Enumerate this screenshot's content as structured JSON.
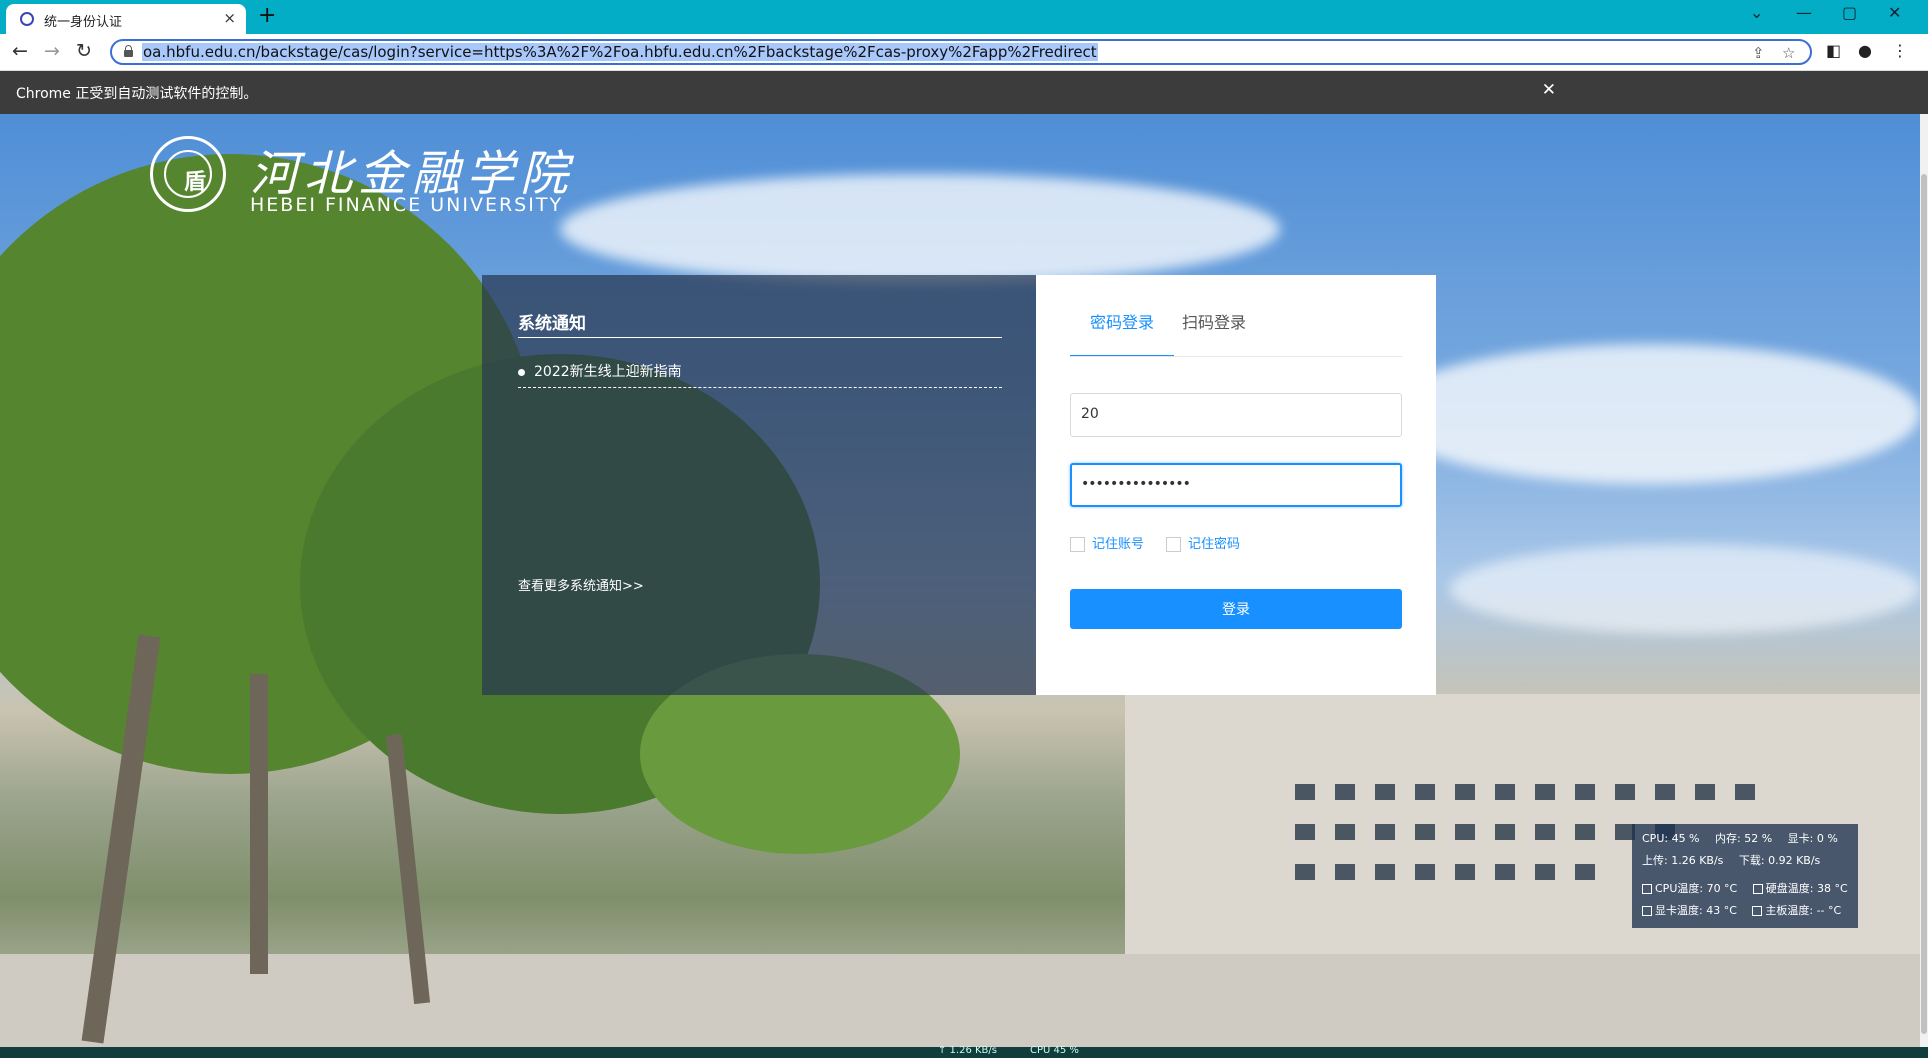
{
  "browser": {
    "tab_title": "统一身份认证",
    "tab_close": "×",
    "new_tab": "+",
    "window_controls": [
      "⌄",
      "—",
      "▢",
      "✕"
    ],
    "url": "oa.hbfu.edu.cn/backstage/cas/login?service=https%3A%2F%2Foa.hbfu.edu.cn%2Fbackstage%2Fcas-proxy%2Fapp%2Fredirect",
    "nav": {
      "back": "←",
      "forward": "→",
      "reload": "↻"
    },
    "automation_message": "Chrome 正受到自动测试软件的控制。",
    "automation_close": "✕"
  },
  "logo": {
    "name_cn": "河北金融学院",
    "name_en": "HEBEI FINANCE UNIVERSITY"
  },
  "notice": {
    "title": "系统通知",
    "items": [
      "2022新生线上迎新指南"
    ],
    "more_link": "查看更多系统通知>>"
  },
  "login": {
    "tabs": [
      "密码登录",
      "扫码登录"
    ],
    "active_tab": 0,
    "username_value": "20",
    "password_value": "•••••••••••••••",
    "remember_account": "记住账号",
    "remember_password": "记住密码",
    "submit": "登录",
    "accent_color": "#1890ff"
  },
  "monitor": {
    "row1": [
      "CPU: 45 %",
      "内存: 52 %",
      "显卡: 0 %"
    ],
    "row2": [
      "上传: 1.26 KB/s",
      "下载: 0.92 KB/s"
    ],
    "row3": [
      "CPU温度: 70 °C",
      "硬盘温度: 38 °C"
    ],
    "row4": [
      "显卡温度: 43 °C",
      "主板温度: -- °C"
    ]
  },
  "taskbar": {
    "upload": "↑ 1.26 KB/s",
    "cpu": "CPU 45 %"
  }
}
